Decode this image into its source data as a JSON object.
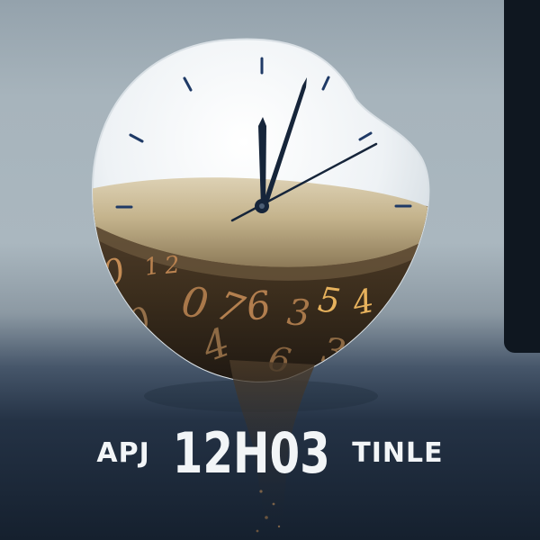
{
  "title": {
    "left": "APJ",
    "center": "12H03",
    "right": "TINLE"
  },
  "decor": {
    "scattered_numerals": [
      "0",
      "1",
      "2",
      "0",
      "7",
      "6",
      "3",
      "4",
      "5",
      "4",
      "3",
      "0",
      "6"
    ]
  },
  "colors": {
    "sky_top": "#94a2ac",
    "ground": "#15202e",
    "panel": "#0f1720",
    "sand": "#b8a37c",
    "liquid": "#3c2e1d",
    "numerals": "#c48c55",
    "highlight_numerals": "#e7b25d",
    "clock_hand": "#16253a"
  },
  "icons": {
    "main_art": "melting-hourglass-clock-icon"
  }
}
